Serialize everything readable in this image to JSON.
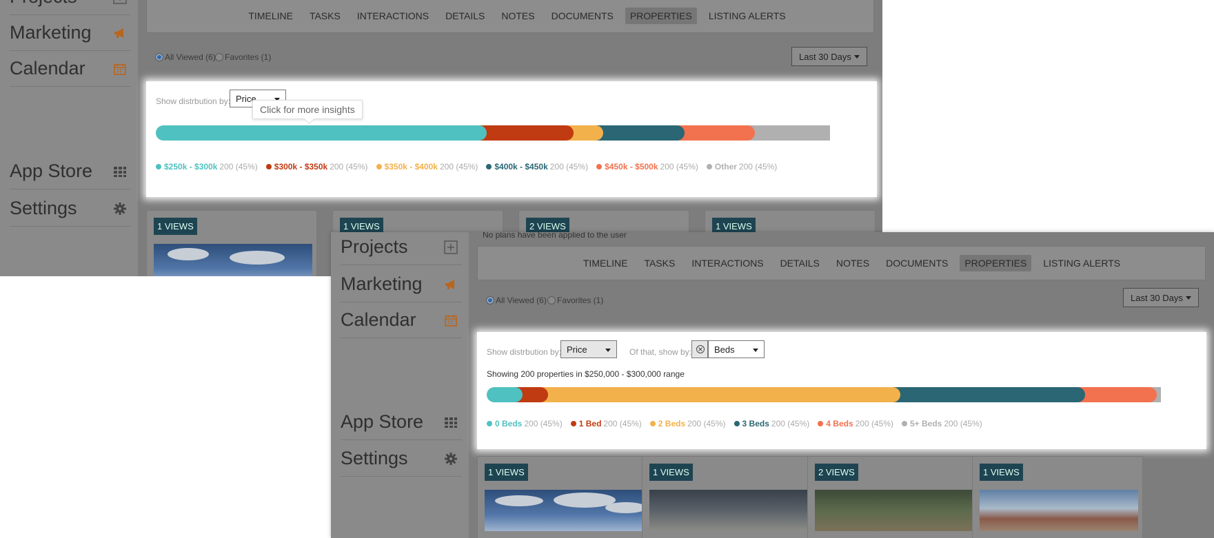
{
  "sidebar": {
    "items": [
      {
        "label": "Projects",
        "icon": "plus-square-icon"
      },
      {
        "label": "Marketing",
        "icon": "megaphone-icon"
      },
      {
        "label": "Calendar",
        "icon": "calendar-icon"
      },
      {
        "label": "App Store",
        "icon": "grid-icon"
      },
      {
        "label": "Settings",
        "icon": "gear-icon"
      }
    ]
  },
  "tabs": [
    "TIMELINE",
    "TASKS",
    "INTERACTIONS",
    "DETAILS",
    "NOTES",
    "DOCUMENTS",
    "PROPERTIES",
    "LISTING ALERTS"
  ],
  "active_tab": "PROPERTIES",
  "filters": {
    "all_viewed": "All Viewed (6)",
    "favorites": "Favorites (1)",
    "range": "Last 30 Days"
  },
  "notice": "No plans have been applied to the user",
  "distribution": {
    "label": "Show distrbution by:",
    "value": "Price",
    "sub_label": "Of that, show by:",
    "sub_value": "Beds",
    "tooltip": "Click for more insights",
    "showing": "Showing 200 properties in $250,000 - $300,000 range"
  },
  "price_legend": [
    {
      "name": "$250k - $300k",
      "count": "200 (45%)",
      "color": "#4fc1c0",
      "share": 46.5
    },
    {
      "name": "$300k - $350k",
      "count": "200 (45%)",
      "color": "#c03a12",
      "share": 13.2
    },
    {
      "name": "$350k - $400k",
      "count": "200 (45%)",
      "color": "#f3b14b",
      "share": 5.3
    },
    {
      "name": "$400k - $450k",
      "count": "200 (45%)",
      "color": "#2a6674",
      "share": 12.4
    },
    {
      "name": "$450k - $500k",
      "count": "200 (45%)",
      "color": "#f2714f",
      "share": 11
    },
    {
      "name": "Other",
      "count": "200 (45%)",
      "color": "#b0b0b0",
      "share": 11.6
    }
  ],
  "beds_legend": [
    {
      "name": "0 Beds",
      "count": "200 (45%)",
      "color": "#4fc1c0",
      "share": 5
    },
    {
      "name": "1 Bed",
      "count": "200 (45%)",
      "color": "#c03a12",
      "share": 4.7
    },
    {
      "name": "2 Beds",
      "count": "200 (45%)",
      "color": "#f3b14b",
      "share": 50.5
    },
    {
      "name": "3 Beds",
      "count": "200 (45%)",
      "color": "#2a6674",
      "share": 27
    },
    {
      "name": "4 Beds",
      "count": "200 (45%)",
      "color": "#f2714f",
      "share": 11.2
    },
    {
      "name": "5+ Beds",
      "count": "200 (45%)",
      "color": "#b0b0b0",
      "share": 1.6
    }
  ],
  "cards": [
    "1 VIEWS",
    "1 VIEWS",
    "2 VIEWS",
    "1 VIEWS"
  ]
}
